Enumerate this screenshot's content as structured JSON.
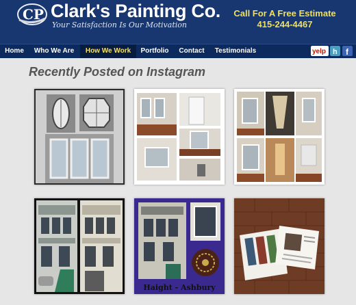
{
  "header": {
    "logo_letters": "CP",
    "brand_name": "Clark's Painting Co.",
    "tagline": "Your Satisfaction Is Our Motivation",
    "cta_line1": "Call For A Free Estimate",
    "cta_phone": "415-244-4467"
  },
  "nav": {
    "items": [
      {
        "label": "Home"
      },
      {
        "label": "Who We Are"
      },
      {
        "label": "How We Work",
        "active": true
      },
      {
        "label": "Portfolio"
      },
      {
        "label": "Contact"
      },
      {
        "label": "Testimonials"
      }
    ],
    "social": [
      {
        "icon": "yelp-icon",
        "text": "yelp"
      },
      {
        "icon": "houzz-icon",
        "text": "h"
      },
      {
        "icon": "facebook-icon",
        "text": "f"
      }
    ]
  },
  "main": {
    "title": "Recently Posted on Instagram",
    "gallery": [
      {
        "name": "window-details-collage"
      },
      {
        "name": "interior-rooms-collage"
      },
      {
        "name": "hallway-rooms-collage"
      },
      {
        "name": "victorian-before-after"
      },
      {
        "name": "haight-ashbury-collage",
        "caption": "Haight - Ashbury"
      },
      {
        "name": "brochure-on-brick"
      }
    ]
  },
  "colors": {
    "header_bg": "#18366f",
    "nav_bg": "#0c2a5e",
    "nav_active_text": "#f4e06a",
    "cta_text": "#f1e05a",
    "page_bg": "#e6e6e6"
  }
}
